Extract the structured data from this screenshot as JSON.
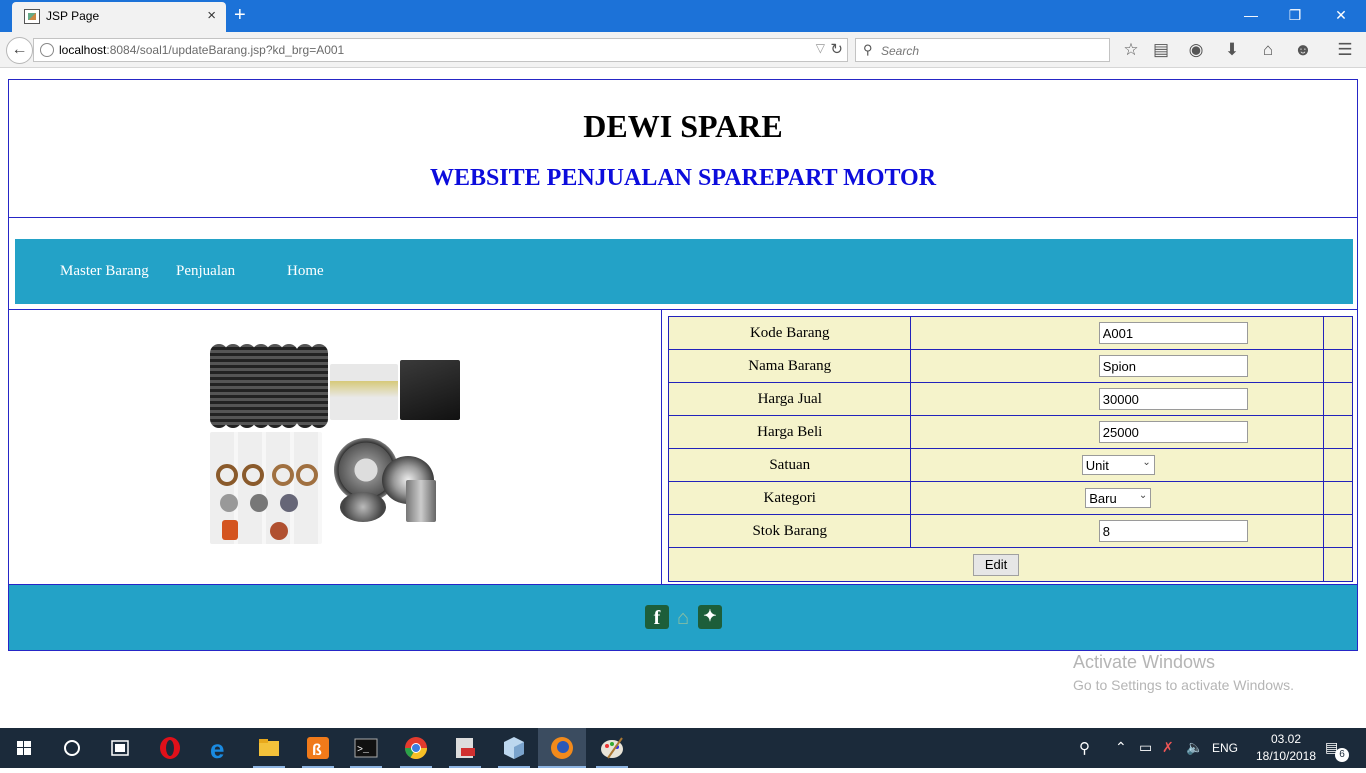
{
  "browser": {
    "tab_title": "JSP Page",
    "tab_close": "×",
    "new_tab": "+",
    "url_host": "localhost",
    "url_rest": ":8084/soal1/updateBarang.jsp?kd_brg=A001",
    "search_placeholder": "Search",
    "window_minimize": "—",
    "window_restore": "❐",
    "window_close": "✕"
  },
  "site": {
    "title": "DEWI SPARE",
    "subtitle": "WEBSITE PENJUALAN SPAREPART MOTOR"
  },
  "menu": {
    "items": [
      "Master Barang",
      "Penjualan",
      "Home"
    ]
  },
  "form": {
    "kode_label": "Kode Barang",
    "kode_value": "A001",
    "nama_label": "Nama Barang",
    "nama_value": "Spion",
    "harga_jual_label": "Harga Jual",
    "harga_jual_value": "30000",
    "harga_beli_label": "Harga Beli",
    "harga_beli_value": "25000",
    "satuan_label": "Satuan",
    "satuan_value": "Unit",
    "kategori_label": "Kategori",
    "kategori_value": "Baru",
    "stok_label": "Stok Barang",
    "stok_value": "8",
    "edit_label": "Edit"
  },
  "footer": {
    "facebook_letter": "f"
  },
  "watermark": {
    "line1": "Activate Windows",
    "line2": "Go to Settings to activate Windows."
  },
  "taskbar": {
    "lang": "ENG",
    "time": "03.02",
    "date": "18/10/2018",
    "notification_count": "6"
  },
  "colors": {
    "accent_teal": "#23a2c7",
    "border_blue": "#2626c6",
    "subtitle_blue": "#0c0cdc",
    "form_bg": "#f5f3cb"
  }
}
